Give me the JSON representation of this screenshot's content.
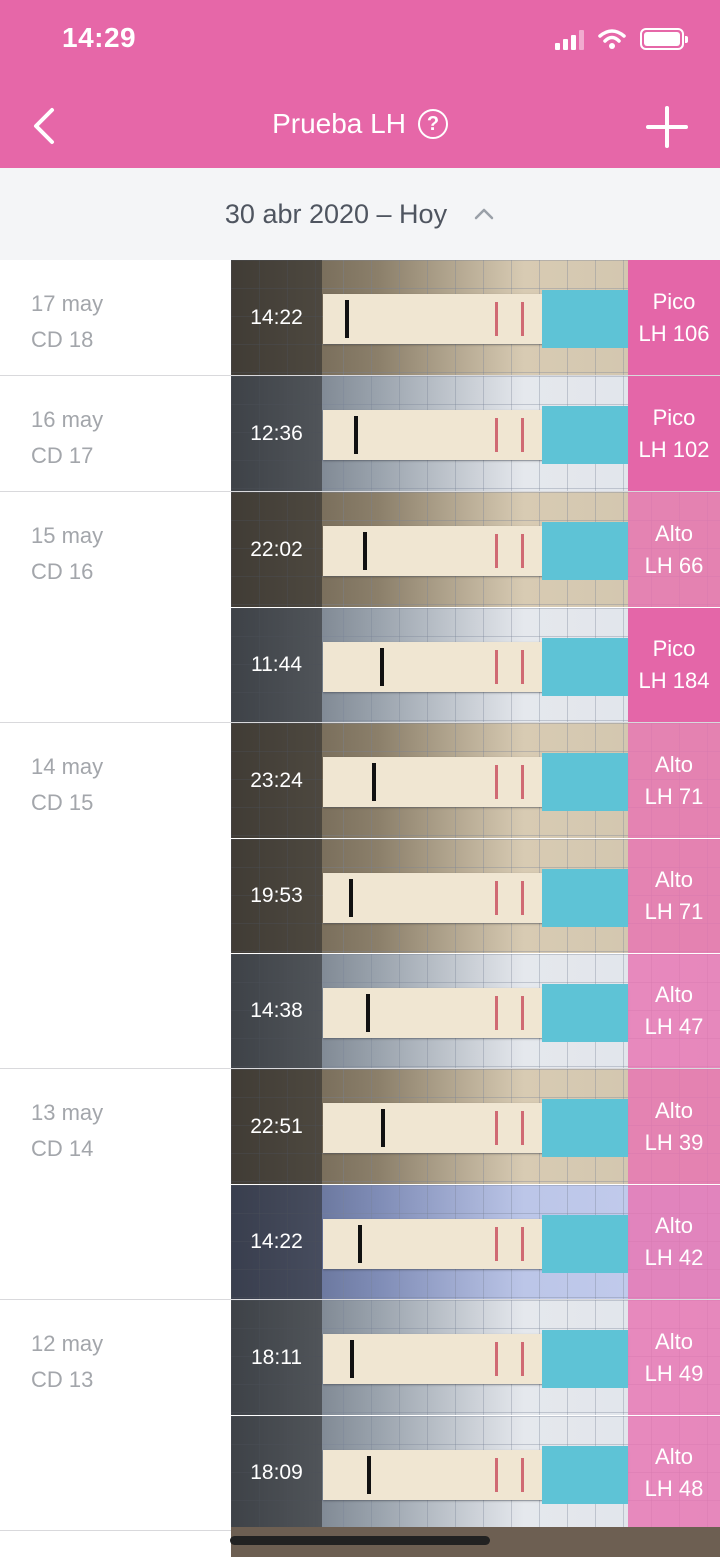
{
  "status_bar": {
    "time": "14:29"
  },
  "header": {
    "title": "Prueba LH",
    "help_glyph": "?",
    "back_icon": "chevron-left-icon",
    "add_icon": "plus-icon"
  },
  "range": {
    "label": "30 abr 2020 – Hoy",
    "toggle_icon": "chevron-up-icon"
  },
  "colors": {
    "brand": "#e667a8",
    "pico": "#e466a8",
    "alto": "#e874b2"
  },
  "days": [
    {
      "date": "17 may",
      "cycle_day": "CD 18",
      "entries": [
        {
          "time": "14:22",
          "level": "Pico",
          "value": "LH 106",
          "kind": "pico",
          "tone": "warm"
        }
      ]
    },
    {
      "date": "16 may",
      "cycle_day": "CD 17",
      "entries": [
        {
          "time": "12:36",
          "level": "Pico",
          "value": "LH 102",
          "kind": "pico",
          "tone": "cool"
        }
      ]
    },
    {
      "date": "15 may",
      "cycle_day": "CD 16",
      "entries": [
        {
          "time": "22:02",
          "level": "Alto",
          "value": "LH 66",
          "kind": "alto",
          "tone": "warm"
        },
        {
          "time": "11:44",
          "level": "Pico",
          "value": "LH 184",
          "kind": "pico",
          "tone": "cool"
        }
      ]
    },
    {
      "date": "14 may",
      "cycle_day": "CD 15",
      "entries": [
        {
          "time": "23:24",
          "level": "Alto",
          "value": "LH 71",
          "kind": "alto",
          "tone": "warm"
        },
        {
          "time": "19:53",
          "level": "Alto",
          "value": "LH 71",
          "kind": "alto",
          "tone": "warm"
        },
        {
          "time": "14:38",
          "level": "Alto",
          "value": "LH 47",
          "kind": "alto",
          "tone": "cool"
        }
      ]
    },
    {
      "date": "13 may",
      "cycle_day": "CD 14",
      "entries": [
        {
          "time": "22:51",
          "level": "Alto",
          "value": "LH 39",
          "kind": "alto",
          "tone": "warm"
        },
        {
          "time": "14:22",
          "level": "Alto",
          "value": "LH 42",
          "kind": "alto",
          "tone": "blue"
        }
      ]
    },
    {
      "date": "12 may",
      "cycle_day": "CD 13",
      "entries": [
        {
          "time": "18:11",
          "level": "Alto",
          "value": "LH 49",
          "kind": "alto",
          "tone": "cool"
        },
        {
          "time": "18:09",
          "level": "Alto",
          "value": "LH 48",
          "kind": "alto",
          "tone": "cool"
        }
      ]
    }
  ]
}
